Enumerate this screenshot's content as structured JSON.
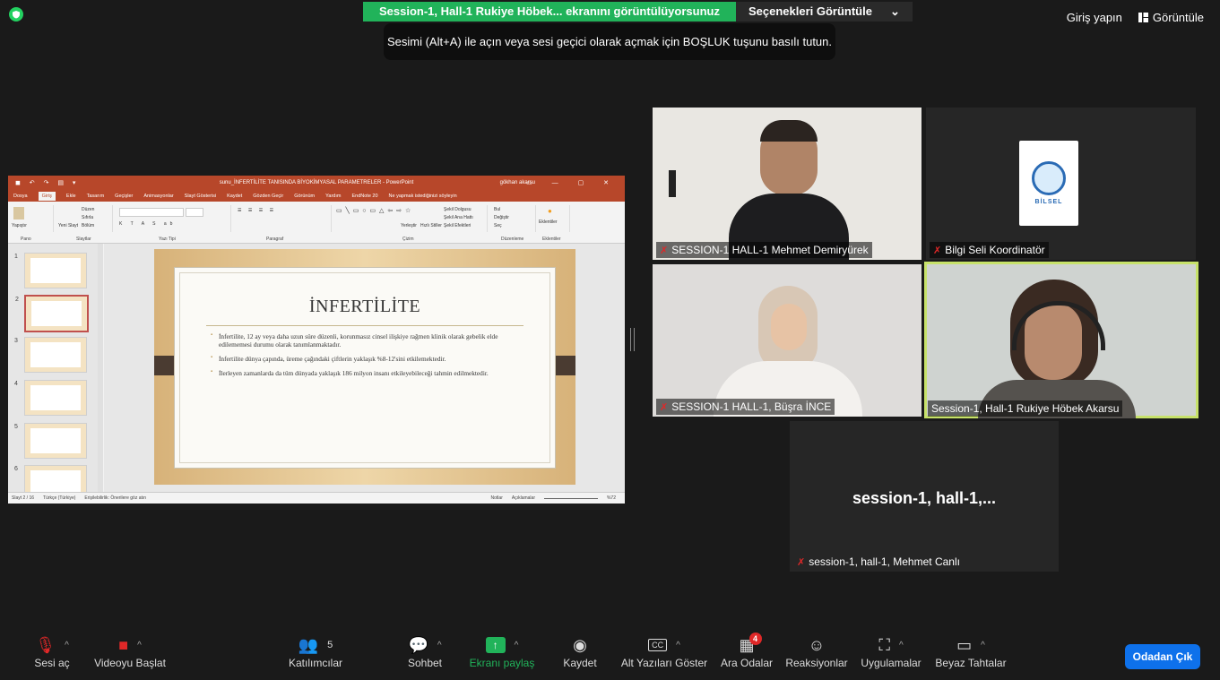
{
  "banner": {
    "sharing": "Session-1, Hall-1 Rukiye Höbek... ekranını görüntülüyorsunuz",
    "options": "Seçenekleri Görüntüle",
    "options_caret": "⌄"
  },
  "tooltip": "Sesimi (Alt+A) ile açın veya sesi geçici olarak açmak için BOŞLUK tuşunu basılı tutun.",
  "topright": {
    "login": "Giriş yapın",
    "view": "Görüntüle"
  },
  "ppt": {
    "title": "sunu_İNFERTİLİTE TANISINDA BİYOKİMYASAL PARAMETRELER - PowerPoint",
    "user": "gökhan akarsu",
    "tabs": [
      "Dosya",
      "Giriş",
      "Ekle",
      "Tasarım",
      "Geçişler",
      "Animasyonlar",
      "Slayt Gösterisi",
      "Kaydet",
      "Gözden Geçir",
      "Görünüm",
      "Yardım",
      "EndNote 20",
      "Ne yapmak istediğinizi söyleyin"
    ],
    "ribbon_groups": [
      "Pano",
      "Slaytlar",
      "Yazı Tipi",
      "Paragraf",
      "Çizim",
      "Düzenleme",
      "Eklentiler"
    ],
    "ribbon_items": {
      "paste": "Yapıştır",
      "new_slide": "Yeni Slayt",
      "layout": "Düzen",
      "reset": "Sıfırla",
      "section": "Bölüm",
      "arrange": "Yerleştir",
      "quick_styles": "Hızlı Stiller",
      "find": "Bul",
      "replace": "Değiştir",
      "select": "Seç",
      "addins": "Eklentiler",
      "fill": "Şekil Dolgusu",
      "outline": "Şekil Ana Hattı",
      "effects": "Şekil Efektleri"
    },
    "slide_numbers": [
      "1",
      "2",
      "3",
      "4",
      "5",
      "6"
    ],
    "slide": {
      "title": "İNFERTİLİTE",
      "bullets": [
        "İnfertilite, 12 ay veya daha uzun süre düzenli, korunmasız cinsel ilişkiye rağmen klinik olarak gebelik elde edilememesi durumu olarak tanımlanmaktadır.",
        "İnfertilite dünya çapında, üreme çağındaki çiftlerin yaklaşık %8-12'sini etkilemektedir.",
        "İlerleyen zamanlarda da tüm dünyada yaklaşık 186 milyon insanı etkileyebileceği tahmin edilmektedir."
      ]
    },
    "status": {
      "slide": "Slayt 2 / 16",
      "lang": "Türkçe (Türkiye)",
      "access": "Erişilebilirlik: Önerilere göz atın",
      "notes": "Notlar",
      "comments": "Açıklamalar",
      "zoom": "%72"
    }
  },
  "participants": [
    {
      "name": "SESSION-1 HALL-1 Mehmet Demiryürek",
      "muted": true
    },
    {
      "name": "Bilgi Seli Koordinatör",
      "muted": true,
      "logo_text": "BİLSEL"
    },
    {
      "name": "SESSION-1 HALL-1, Büşra İNCE",
      "muted": true
    },
    {
      "name": "Session-1, Hall-1 Rukiye Höbek Akarsu",
      "muted": false
    },
    {
      "name": "session-1, hall-1, Mehmet Canlı",
      "muted": true,
      "big": "session-1,  hall-1,..."
    }
  ],
  "toolbar": {
    "unmute": "Sesi aç",
    "start_video": "Videoyu Başlat",
    "participants": "Katılımcılar",
    "participant_count": "5",
    "chat": "Sohbet",
    "share": "Ekranı paylaş",
    "record": "Kaydet",
    "captions": "Alt Yazıları Göster",
    "breakout": "Ara Odalar",
    "breakout_count": "4",
    "reactions": "Reaksiyonlar",
    "apps": "Uygulamalar",
    "whiteboard": "Beyaz Tahtalar",
    "leave": "Odadan Çık",
    "cc": "CC"
  },
  "colors": {
    "share_green": "#21b35a",
    "leave_blue": "#0e71eb",
    "ppt_red": "#b7472a",
    "speaker_outline": "#c7e26a",
    "muted_red": "#e02828"
  }
}
